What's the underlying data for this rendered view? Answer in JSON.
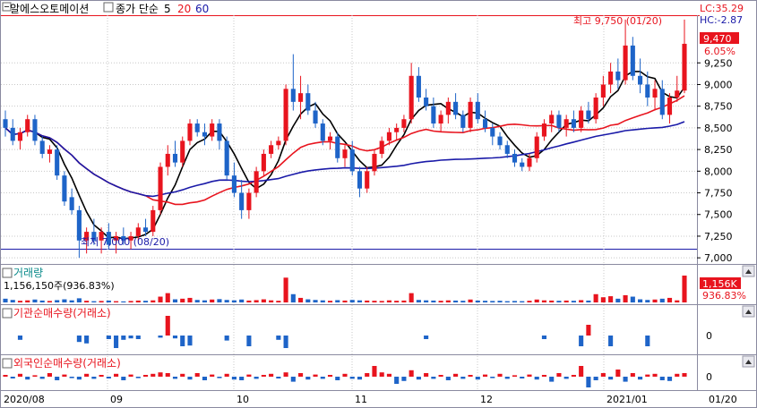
{
  "header": {
    "stock_name": "알에스오토메이션",
    "ma_title": "종가 단순",
    "ma_periods": [
      "5",
      "20",
      "60"
    ],
    "ma_colors": [
      "#000000",
      "#e8141e",
      "#1a1aa8"
    ],
    "lc_label": "LC:35.29",
    "hc_label": "HC:-2.87"
  },
  "price_panel": {
    "high_annotation": "최고 9,750 (01/20)",
    "low_annotation": "최저 7,000 (08/20)",
    "last_price_tag": "9,470",
    "change_pct_tag": "6.05%",
    "y_ticks": [
      "9,250",
      "9,000",
      "8,750",
      "8,500",
      "8,250",
      "8,000",
      "7,750",
      "7,500",
      "7,250",
      "7,000"
    ]
  },
  "volume_panel": {
    "title": "거래량",
    "value_text": "1,156,150주(936.83%)",
    "last_tag": "1,156K",
    "pct_tag": "936.83%"
  },
  "inst_panel": {
    "title": "기관순매수량(거래소)",
    "zero_label": "0"
  },
  "foreign_panel": {
    "title": "외국인순매수량(거래소)",
    "zero_label": "0"
  },
  "x_axis": {
    "labels": [
      "2020/08",
      "09",
      "10",
      "11",
      "12",
      "2021/01",
      "01/20"
    ]
  },
  "colors": {
    "up": "#e8141e",
    "down": "#1e64c8",
    "grid": "#c8c8c8",
    "frame": "#8a8aa0"
  },
  "chart_data": {
    "type": "candlestick",
    "y_range": [
      6950,
      9800
    ],
    "high": {
      "value": 9750,
      "date": "01/20"
    },
    "low": {
      "value": 7000,
      "date": "08/20"
    },
    "ohlc": [
      [
        8600,
        8700,
        8400,
        8500
      ],
      [
        8500,
        8600,
        8300,
        8350
      ],
      [
        8350,
        8500,
        8250,
        8450
      ],
      [
        8450,
        8650,
        8400,
        8600
      ],
      [
        8600,
        8650,
        8300,
        8350
      ],
      [
        8350,
        8400,
        8150,
        8200
      ],
      [
        8200,
        8300,
        8100,
        8250
      ],
      [
        8250,
        8300,
        7900,
        7950
      ],
      [
        7950,
        8000,
        7600,
        7650
      ],
      [
        7700,
        7800,
        7500,
        7550
      ],
      [
        7550,
        7600,
        7000,
        7200
      ],
      [
        7200,
        7350,
        7050,
        7300
      ],
      [
        7300,
        7450,
        7150,
        7200
      ],
      [
        7200,
        7350,
        7050,
        7300
      ],
      [
        7300,
        7400,
        7100,
        7150
      ],
      [
        7200,
        7300,
        7050,
        7250
      ],
      [
        7250,
        7350,
        7150,
        7200
      ],
      [
        7200,
        7300,
        7100,
        7250
      ],
      [
        7250,
        7400,
        7200,
        7350
      ],
      [
        7350,
        7450,
        7250,
        7300
      ],
      [
        7300,
        7600,
        7250,
        7550
      ],
      [
        7550,
        8100,
        7500,
        8050
      ],
      [
        8050,
        8300,
        7950,
        8200
      ],
      [
        8200,
        8350,
        8050,
        8100
      ],
      [
        8100,
        8400,
        8050,
        8350
      ],
      [
        8350,
        8600,
        8300,
        8550
      ],
      [
        8550,
        8600,
        8400,
        8450
      ],
      [
        8450,
        8550,
        8300,
        8400
      ],
      [
        8400,
        8600,
        8350,
        8550
      ],
      [
        8550,
        8600,
        8250,
        8350
      ],
      [
        8350,
        8400,
        7900,
        7950
      ],
      [
        7950,
        8100,
        7700,
        7750
      ],
      [
        7750,
        7900,
        7450,
        7550
      ],
      [
        7550,
        7800,
        7450,
        7750
      ],
      [
        7750,
        8050,
        7700,
        8000
      ],
      [
        8000,
        8250,
        7950,
        8200
      ],
      [
        8200,
        8350,
        8150,
        8300
      ],
      [
        8300,
        8400,
        8250,
        8350
      ],
      [
        8350,
        9000,
        8300,
        8950
      ],
      [
        8950,
        9350,
        8700,
        8800
      ],
      [
        8800,
        9100,
        8600,
        8900
      ],
      [
        8900,
        9000,
        8650,
        8700
      ],
      [
        8700,
        8800,
        8500,
        8550
      ],
      [
        8550,
        8600,
        8300,
        8350
      ],
      [
        8350,
        8450,
        8250,
        8400
      ],
      [
        8400,
        8450,
        8100,
        8150
      ],
      [
        8150,
        8300,
        8050,
        8250
      ],
      [
        8250,
        8350,
        7950,
        8000
      ],
      [
        8000,
        8050,
        7700,
        7800
      ],
      [
        7800,
        8050,
        7750,
        8000
      ],
      [
        8000,
        8250,
        7950,
        8200
      ],
      [
        8200,
        8400,
        8150,
        8350
      ],
      [
        8350,
        8500,
        8300,
        8450
      ],
      [
        8450,
        8550,
        8350,
        8500
      ],
      [
        8500,
        8650,
        8450,
        8600
      ],
      [
        8600,
        9250,
        8550,
        9100
      ],
      [
        9100,
        9200,
        8800,
        8850
      ],
      [
        8850,
        8950,
        8700,
        8750
      ],
      [
        8750,
        8850,
        8500,
        8550
      ],
      [
        8550,
        8700,
        8450,
        8650
      ],
      [
        8650,
        8850,
        8550,
        8800
      ],
      [
        8800,
        8900,
        8600,
        8650
      ],
      [
        8650,
        8700,
        8450,
        8500
      ],
      [
        8500,
        8850,
        8450,
        8800
      ],
      [
        8800,
        8900,
        8550,
        8600
      ],
      [
        8600,
        8700,
        8450,
        8500
      ],
      [
        8500,
        8550,
        8300,
        8400
      ],
      [
        8400,
        8450,
        8250,
        8300
      ],
      [
        8300,
        8350,
        8150,
        8200
      ],
      [
        8200,
        8250,
        8050,
        8100
      ],
      [
        8100,
        8150,
        8000,
        8050
      ],
      [
        8050,
        8200,
        8000,
        8150
      ],
      [
        8150,
        8450,
        8100,
        8400
      ],
      [
        8400,
        8600,
        8350,
        8550
      ],
      [
        8550,
        8700,
        8450,
        8650
      ],
      [
        8650,
        8700,
        8450,
        8500
      ],
      [
        8500,
        8650,
        8400,
        8600
      ],
      [
        8600,
        8700,
        8450,
        8500
      ],
      [
        8500,
        8750,
        8450,
        8700
      ],
      [
        8700,
        8800,
        8550,
        8600
      ],
      [
        8600,
        8900,
        8550,
        8850
      ],
      [
        8850,
        9100,
        8750,
        9000
      ],
      [
        9000,
        9250,
        8900,
        9150
      ],
      [
        9150,
        9300,
        8950,
        9050
      ],
      [
        9050,
        9750,
        9000,
        9450
      ],
      [
        9450,
        9550,
        9050,
        9100
      ],
      [
        9100,
        9300,
        8900,
        9000
      ],
      [
        9000,
        9150,
        8750,
        8850
      ],
      [
        8850,
        9050,
        8700,
        8950
      ],
      [
        8950,
        9050,
        8600,
        8650
      ],
      [
        8650,
        8900,
        8550,
        8850
      ],
      [
        8850,
        9100,
        8800,
        8930
      ],
      [
        8930,
        9750,
        8900,
        9470
      ]
    ],
    "volume": [
      18,
      12,
      8,
      10,
      14,
      9,
      7,
      11,
      15,
      10,
      20,
      8,
      6,
      7,
      9,
      6,
      5,
      7,
      9,
      8,
      10,
      28,
      45,
      15,
      18,
      22,
      12,
      10,
      14,
      16,
      12,
      10,
      14,
      9,
      11,
      15,
      10,
      8,
      120,
      40,
      22,
      15,
      12,
      10,
      8,
      11,
      9,
      12,
      10,
      9,
      8,
      7,
      10,
      8,
      9,
      45,
      12,
      10,
      9,
      8,
      10,
      9,
      8,
      14,
      9,
      8,
      7,
      8,
      6,
      7,
      6,
      8,
      14,
      10,
      9,
      8,
      9,
      8,
      11,
      9,
      40,
      25,
      30,
      18,
      35,
      28,
      15,
      12,
      14,
      18,
      22,
      10,
      130
    ],
    "institution_net": [
      0,
      0,
      -12,
      0,
      0,
      0,
      0,
      0,
      0,
      0,
      -18,
      -22,
      0,
      0,
      -10,
      -35,
      -12,
      -8,
      -10,
      0,
      0,
      -6,
      55,
      -8,
      -30,
      -28,
      0,
      0,
      0,
      0,
      -14,
      0,
      0,
      -30,
      0,
      0,
      0,
      -12,
      -35,
      0,
      0,
      0,
      0,
      0,
      0,
      0,
      0,
      0,
      0,
      0,
      0,
      0,
      0,
      0,
      0,
      0,
      0,
      -10,
      0,
      0,
      0,
      0,
      0,
      0,
      0,
      0,
      0,
      0,
      0,
      0,
      0,
      0,
      0,
      -10,
      0,
      0,
      0,
      0,
      -30,
      30,
      0,
      0,
      -30,
      0,
      0,
      0,
      0,
      -30,
      0,
      0,
      0,
      0,
      0
    ],
    "foreign_net": [
      5,
      -5,
      8,
      -8,
      4,
      -6,
      10,
      -10,
      6,
      -4,
      -8,
      8,
      -6,
      5,
      -5,
      8,
      -10,
      6,
      -4,
      5,
      8,
      12,
      10,
      -6,
      8,
      -8,
      10,
      -10,
      6,
      -4,
      8,
      -8,
      -10,
      6,
      -6,
      5,
      8,
      -5,
      12,
      -14,
      10,
      -8,
      6,
      -6,
      5,
      -10,
      8,
      -6,
      -8,
      10,
      30,
      12,
      8,
      -20,
      -12,
      18,
      -8,
      10,
      -6,
      5,
      -10,
      8,
      -6,
      5,
      -8,
      6,
      -4,
      8,
      -6,
      4,
      -5,
      6,
      -8,
      5,
      -14,
      10,
      -6,
      5,
      30,
      -30,
      -10,
      10,
      -8,
      20,
      -14,
      10,
      -8,
      6,
      8,
      -10,
      -12,
      8,
      10
    ]
  }
}
